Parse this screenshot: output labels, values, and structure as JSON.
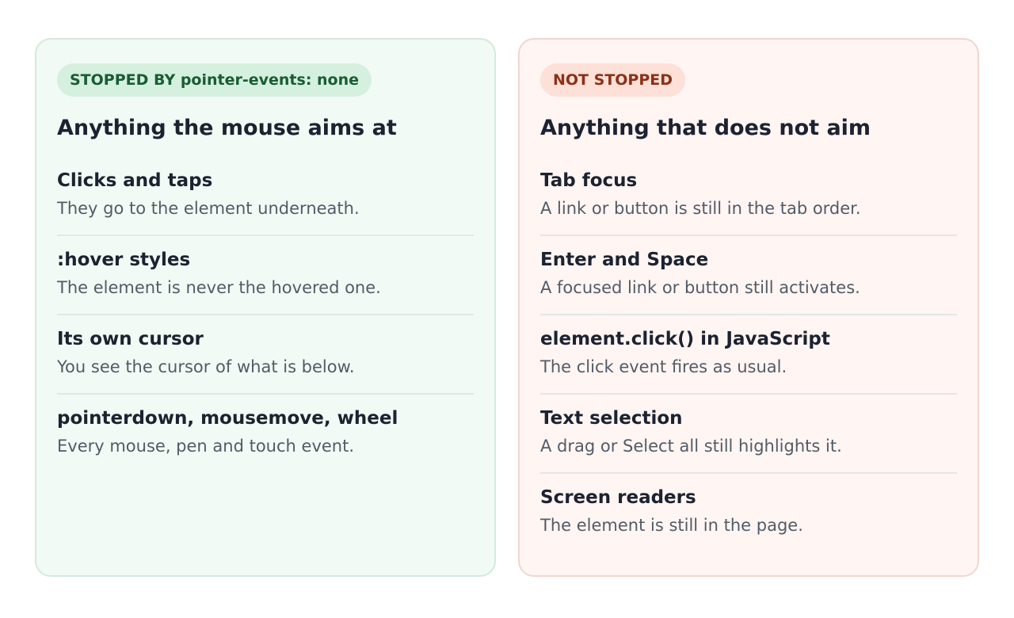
{
  "left": {
    "badge": "STOPPED BY pointer-events: none",
    "heading": "Anything the mouse aims at",
    "items": [
      {
        "title": "Clicks and taps",
        "desc": "They go to the element underneath."
      },
      {
        "title": ":hover styles",
        "desc": "The element is never the hovered one."
      },
      {
        "title": "Its own cursor",
        "desc": "You see the cursor of what is below."
      },
      {
        "title": "pointerdown, mousemove, wheel",
        "desc": "Every mouse, pen and touch event."
      }
    ]
  },
  "right": {
    "badge": "NOT STOPPED",
    "heading": "Anything that does not aim",
    "items": [
      {
        "title": "Tab focus",
        "desc": "A link or button is still in the tab order."
      },
      {
        "title": "Enter and Space",
        "desc": "A focused link or button still activates."
      },
      {
        "title": "element.click() in JavaScript",
        "desc": "The click event fires as usual."
      },
      {
        "title": "Text selection",
        "desc": "A drag or Select all still highlights it."
      },
      {
        "title": "Screen readers",
        "desc": "The element is still in the page."
      }
    ]
  },
  "colors": {
    "stopped_bg": "#f2faf5",
    "stopped_badge": "#d5f0de",
    "stopped_badge_text": "#195c34",
    "not_stopped_bg": "#fff5f3",
    "not_stopped_badge": "#fde0d8",
    "not_stopped_badge_text": "#8a3118"
  }
}
